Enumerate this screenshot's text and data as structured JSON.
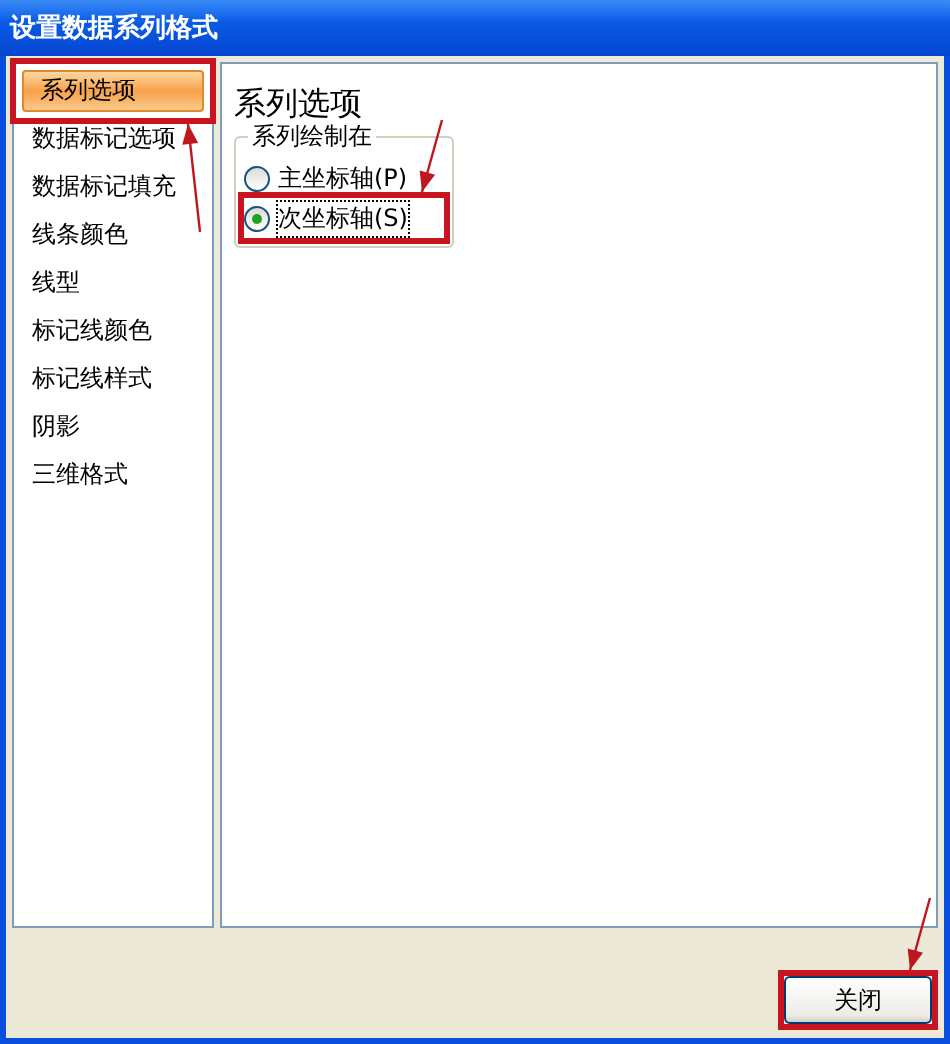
{
  "window": {
    "title": "设置数据系列格式"
  },
  "sidebar": {
    "items": [
      {
        "label": "系列选项",
        "selected": true,
        "highlighted": true,
        "arrow_below": true
      },
      {
        "label": "数据标记选项",
        "selected": false
      },
      {
        "label": "数据标记填充",
        "selected": false
      },
      {
        "label": "线条颜色",
        "selected": false
      },
      {
        "label": "线型",
        "selected": false
      },
      {
        "label": "标记线颜色",
        "selected": false
      },
      {
        "label": "标记线样式",
        "selected": false
      },
      {
        "label": "阴影",
        "selected": false
      },
      {
        "label": "三维格式",
        "selected": false
      }
    ]
  },
  "panel": {
    "heading": "系列选项",
    "group": {
      "title": "系列绘制在",
      "options": [
        {
          "label": "主坐标轴(P)",
          "selected": false
        },
        {
          "label": "次坐标轴(S)",
          "selected": true,
          "highlighted": true,
          "arrow_above": true
        }
      ]
    }
  },
  "buttons": [
    {
      "label": "关闭",
      "highlighted": true,
      "arrow_above": true
    }
  ]
}
